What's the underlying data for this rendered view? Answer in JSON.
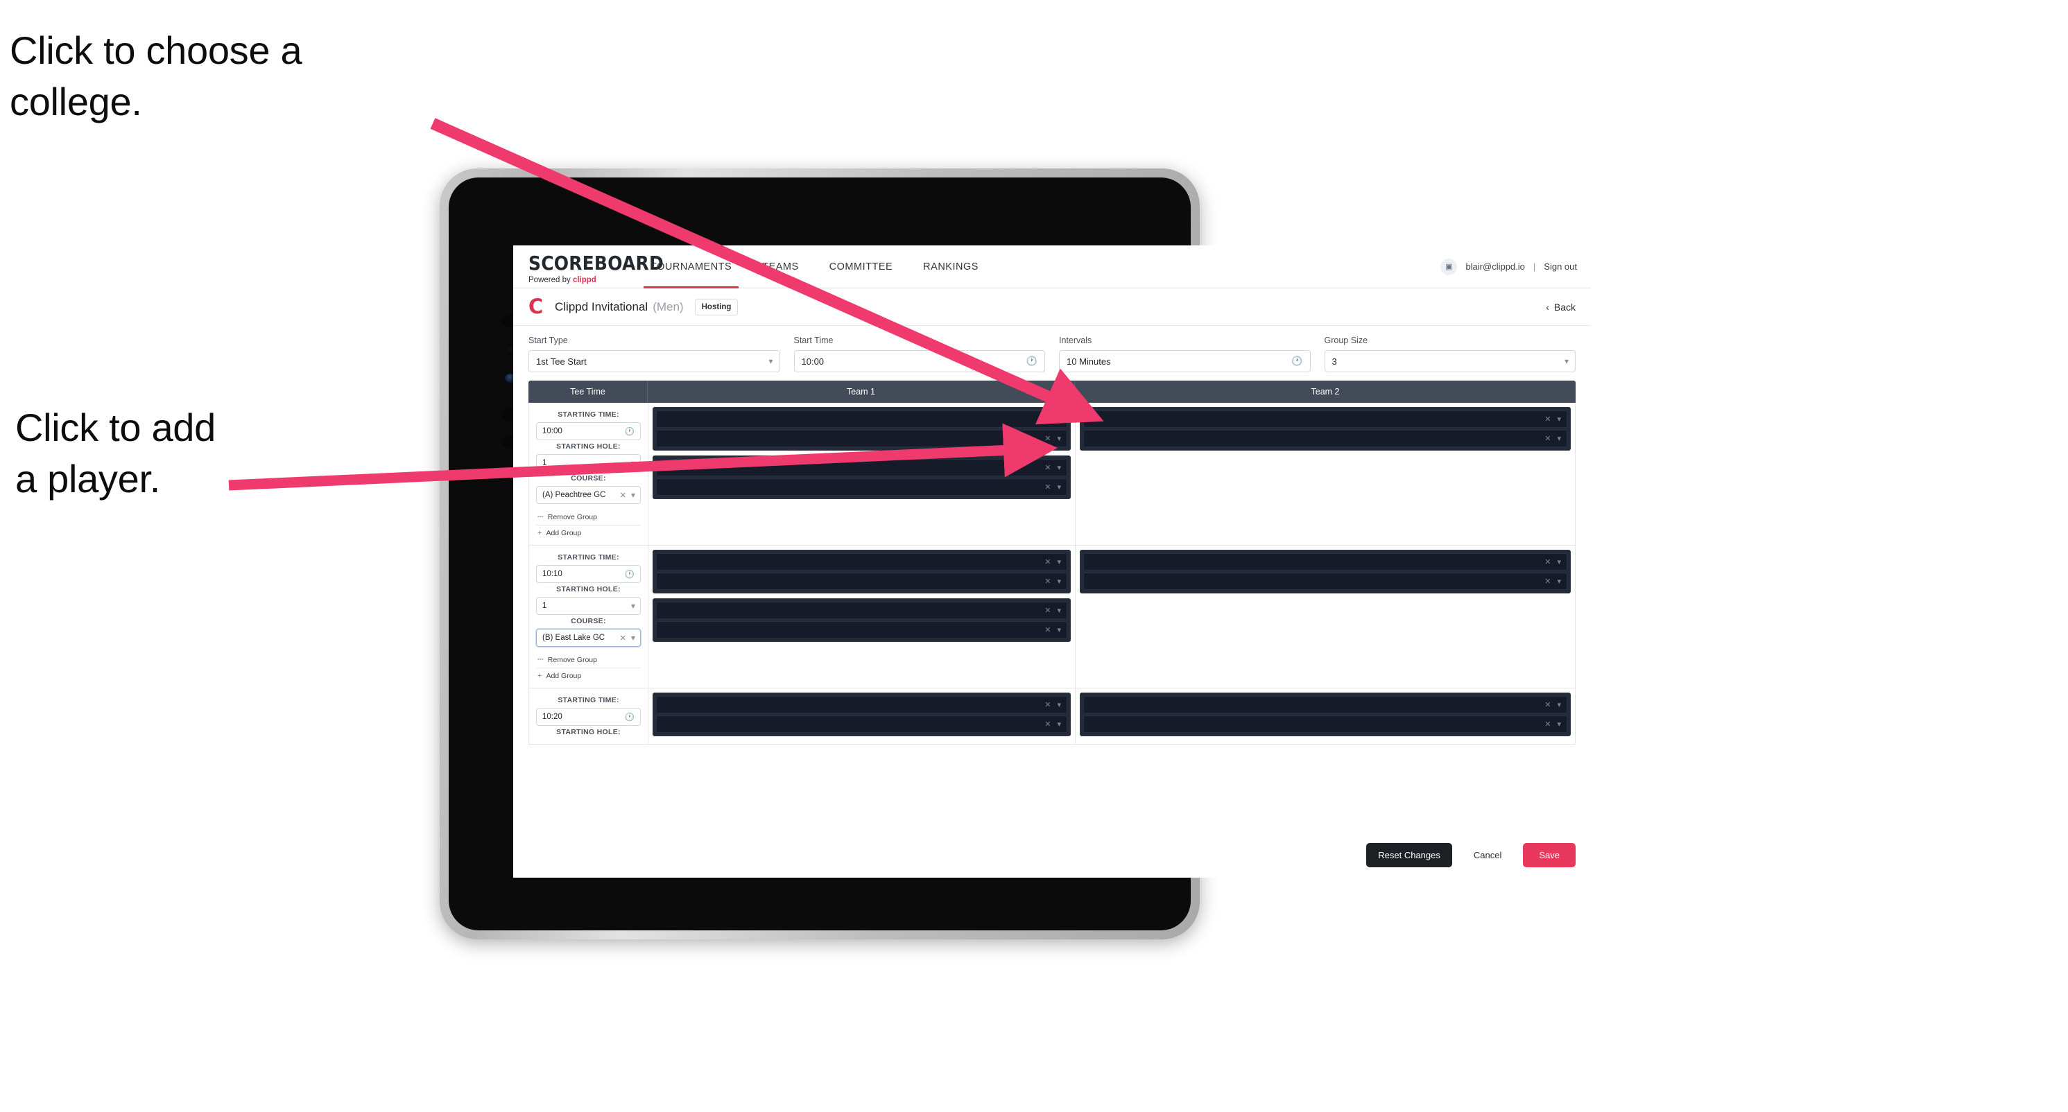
{
  "annotations": {
    "college": "Click to choose a\ncollege.",
    "player": "Click to add\na player.",
    "arrow_color": "#ef3a6e"
  },
  "app": {
    "brand": {
      "title": "SCOREBOARD",
      "powered_prefix": "Powered by",
      "powered_brand": "clippd"
    },
    "nav": [
      {
        "label": "TOURNAMENTS",
        "active": true
      },
      {
        "label": "TEAMS",
        "active": false
      },
      {
        "label": "COMMITTEE",
        "active": false
      },
      {
        "label": "RANKINGS",
        "active": false
      }
    ],
    "account": {
      "avatar_glyph": "▣",
      "email": "blair@clippd.io",
      "separator": "|",
      "sign_out": "Sign out"
    },
    "subheader": {
      "logo_letter": "C",
      "event_name": "Clippd Invitational",
      "gender": "(Men)",
      "badge": "Hosting",
      "back_label": "Back",
      "back_icon": "‹"
    },
    "controls": [
      {
        "label": "Start Type",
        "value": "1st Tee Start",
        "icon": "stepper"
      },
      {
        "label": "Start Time",
        "value": "10:00",
        "icon": "clock"
      },
      {
        "label": "Intervals",
        "value": "10 Minutes",
        "icon": "clock"
      },
      {
        "label": "Group Size",
        "value": "3",
        "icon": "stepper"
      }
    ],
    "table": {
      "columns": [
        "Tee Time",
        "Team 1",
        "Team 2"
      ],
      "labels": {
        "starting_time": "STARTING TIME:",
        "starting_hole": "STARTING HOLE:",
        "course": "COURSE:",
        "remove_group": "Remove Group",
        "add_group": "Add Group",
        "remove_icon": "Ὕ1",
        "add_icon": "+",
        "clock_icon": "◴",
        "clear_icon": "×",
        "stepper_icon": "⌃"
      },
      "groups": [
        {
          "starting_time": "10:00",
          "starting_hole": "1",
          "course": "(A) Peachtree GC",
          "course_focused": false,
          "team1_panels": [
            2,
            2
          ],
          "team2_panels": [
            2
          ]
        },
        {
          "starting_time": "10:10",
          "starting_hole": "1",
          "course": "(B) East Lake GC",
          "course_focused": true,
          "team1_panels": [
            2,
            2
          ],
          "team2_panels": [
            2
          ]
        },
        {
          "starting_time": "10:20",
          "starting_hole": "",
          "course": "",
          "course_focused": false,
          "team1_panels": [
            2
          ],
          "team2_panels": [
            2
          ]
        }
      ]
    },
    "footer": {
      "reset": "Reset Changes",
      "cancel": "Cancel",
      "save": "Save"
    },
    "colors": {
      "accent": "#d6344f",
      "save": "#e8395c",
      "table_header": "#434a58",
      "redact_panel": "#232a38",
      "redact_row": "#151b28"
    }
  }
}
